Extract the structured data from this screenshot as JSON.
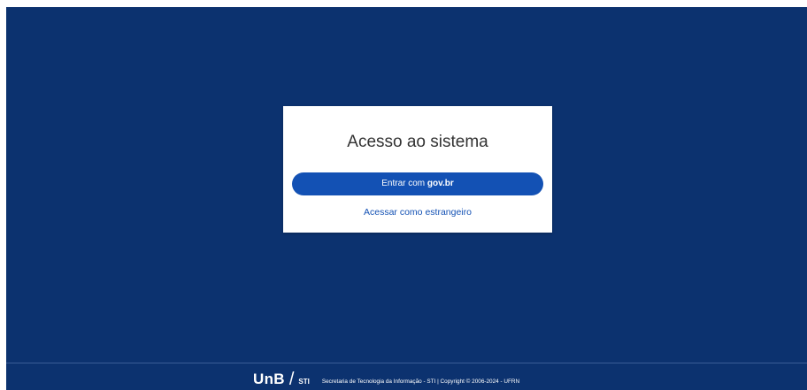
{
  "login": {
    "title": "Acesso ao sistema",
    "govbr_button": {
      "prefix": "Entrar com ",
      "brand": "gov.br"
    },
    "foreign_link": "Acessar como estrangeiro"
  },
  "footer": {
    "logo_unb": "UnB",
    "logo_slash": "/",
    "logo_sti": "STI",
    "text": "Secretaria de Tecnologia da Informação - STI | Copyright © 2006-2024 - UFRN"
  },
  "colors": {
    "background": "#0c326f",
    "card": "#ffffff",
    "primary": "#1351b4"
  }
}
